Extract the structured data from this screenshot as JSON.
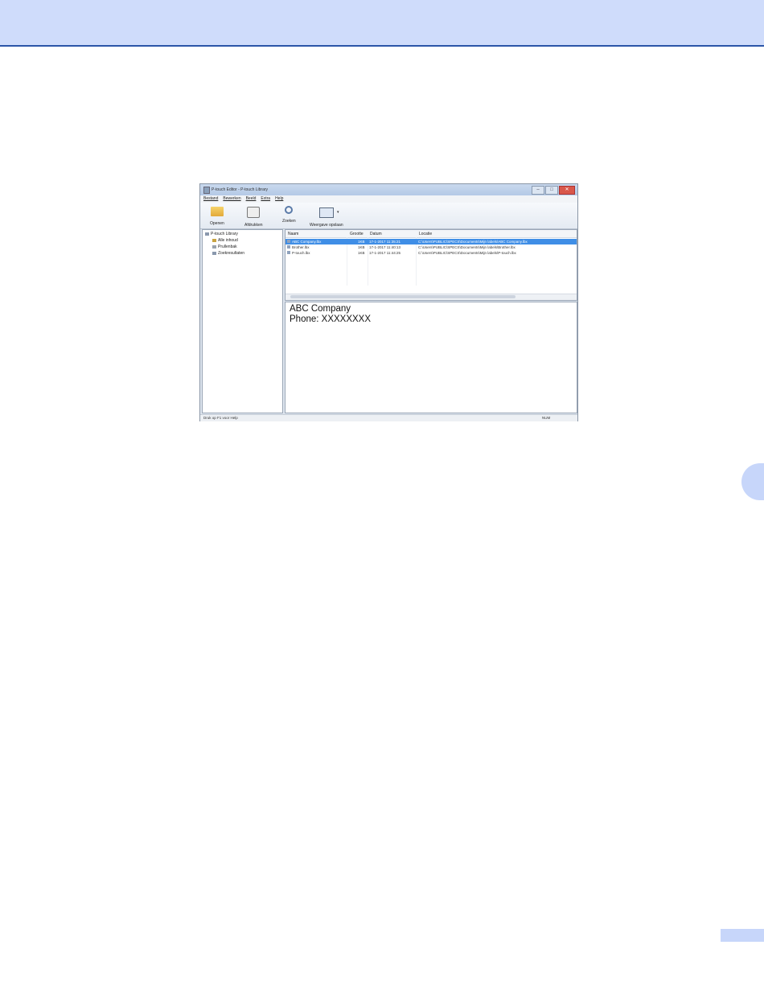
{
  "window": {
    "title": "P-touch Editor - P-touch Library",
    "buttons": {
      "minimize": "–",
      "maximize": "□",
      "close": "✕"
    }
  },
  "menu": [
    "Bestand",
    "Bewerken",
    "Beeld",
    "Extra",
    "Help"
  ],
  "toolbar": {
    "open": "Openen",
    "print": "Afdrukken",
    "search": "Zoeken",
    "view": "Weergave opslaan",
    "view_arrow": "▾"
  },
  "tree": {
    "root": "P-touch Library",
    "items": [
      "Alle inhoud",
      "Prullenbak",
      "Zoekresultaten"
    ]
  },
  "list": {
    "headers": {
      "name": "Naam",
      "size": "Grootte",
      "date": "Datum",
      "location": "Locatie"
    },
    "rows": [
      {
        "name": "ABC Company.lbx",
        "size": "1KB",
        "date": "17-1-2017 11:35:21",
        "location": "C:\\Users\\PUBLIC\\SPECS\\Documents\\Mijn labels\\ABC Company.lbx",
        "selected": true
      },
      {
        "name": "Brother.lbx",
        "size": "1KB",
        "date": "17-1-2017 11:40:13",
        "location": "C:\\Users\\PUBLIC\\SPECS\\Documents\\Mijn labels\\Brother.lbx",
        "selected": false
      },
      {
        "name": "P-touch.lbx",
        "size": "1KB",
        "date": "17-1-2017 11:44:25",
        "location": "C:\\Users\\PUBLIC\\SPECS\\Documents\\Mijn labels\\P-touch.lbx",
        "selected": false
      }
    ]
  },
  "preview": {
    "line1": "ABC Company",
    "line2": "Phone: XXXXXXXX"
  },
  "status": {
    "left": "Druk op F1 voor Help",
    "right": "NUM"
  }
}
